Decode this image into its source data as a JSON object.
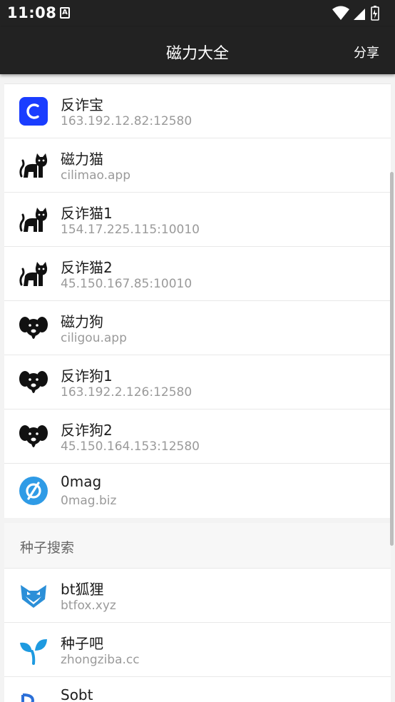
{
  "status_bar": {
    "time": "11:08"
  },
  "app_bar": {
    "title": "磁力大全",
    "share_label": "分享"
  },
  "sites": [
    {
      "name": "反诈宝",
      "address": "163.192.12.82:12580",
      "icon": "c-logo-icon"
    },
    {
      "name": "磁力猫",
      "address": "cilimao.app",
      "icon": "cat-icon"
    },
    {
      "name": "反诈猫1",
      "address": "154.17.225.115:10010",
      "icon": "cat-icon"
    },
    {
      "name": "反诈猫2",
      "address": "45.150.167.85:10010",
      "icon": "cat-icon"
    },
    {
      "name": "磁力狗",
      "address": "ciligou.app",
      "icon": "dog-icon"
    },
    {
      "name": "反诈狗1",
      "address": "163.192.2.126:12580",
      "icon": "dog-icon"
    },
    {
      "name": "反诈狗2",
      "address": "45.150.164.153:12580",
      "icon": "dog-icon"
    },
    {
      "name": "0mag",
      "address": "0mag.biz",
      "icon": "empty-set-icon"
    }
  ],
  "torrent_section": {
    "title": "种子搜索",
    "items": [
      {
        "name": "bt狐狸",
        "address": "btfox.xyz",
        "icon": "fox-icon"
      },
      {
        "name": "种子吧",
        "address": "zhongziba.cc",
        "icon": "sprout-icon"
      },
      {
        "name": "Sobt",
        "address": "",
        "icon": "sobt-logo-icon"
      }
    ]
  },
  "colors": {
    "app_bar": "#222222",
    "c_logo": "#1a3dff",
    "empty_set_logo": "#2f9be6",
    "fox_logo": "#2b8fd8",
    "sprout_logo": "#1e9ae0"
  }
}
